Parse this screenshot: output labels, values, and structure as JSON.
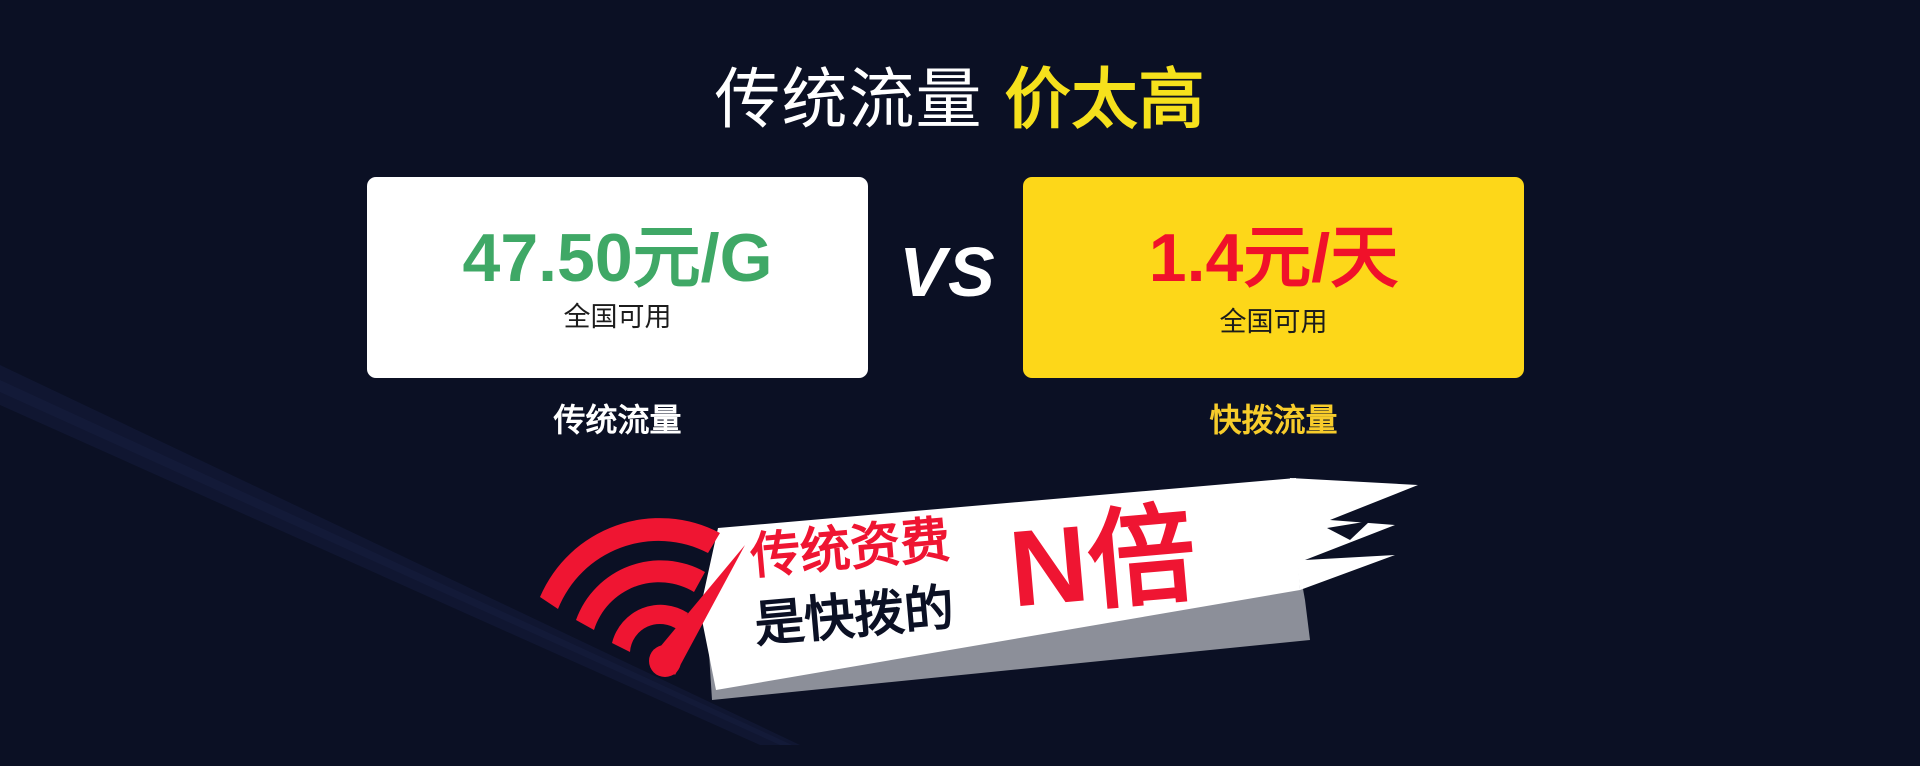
{
  "headline": {
    "plain": "传统流量",
    "accent": "价太高"
  },
  "comparison": {
    "traditional": {
      "price": "47.50元/G",
      "availability": "全国可用",
      "label": "传统流量"
    },
    "versus": "VS",
    "kuaiba": {
      "price": "1.4元/天",
      "availability": "全国可用",
      "label": "快拨流量"
    }
  },
  "banner": {
    "line1": "传统资费",
    "line2": "是快拨的",
    "multiplier": "N倍",
    "icon": "wifi-signal-icon"
  },
  "colors": {
    "background": "#0b1024",
    "accent_yellow": "#f6e11c",
    "card_yellow": "#fdd719",
    "price_green": "#3fa866",
    "price_red": "#f0112a",
    "banner_red": "#ef1532"
  }
}
